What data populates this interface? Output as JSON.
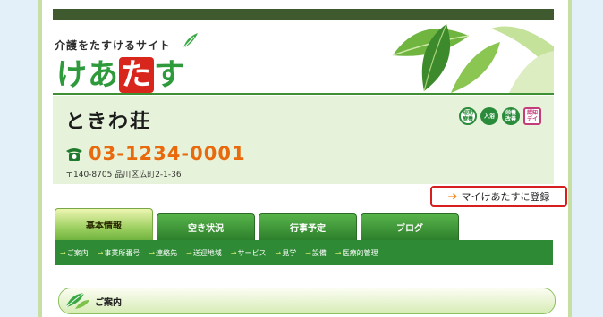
{
  "header": {
    "tagline": "介護をたすけるサイト",
    "logo": {
      "part1": "けあ",
      "highlight": "た",
      "part2": "す"
    }
  },
  "facility": {
    "name": "ときわ荘",
    "phone": "03-1234-0001",
    "address": "〒140-8705 品川区広町2-1-36",
    "badges": [
      {
        "label": "短期\n療養",
        "icon": "short-stay-icon"
      },
      {
        "label": "入浴",
        "icon": "bath-icon"
      },
      {
        "label": "栄養\n改善",
        "icon": "nutrition-icon"
      },
      {
        "label": "認知\nデイ",
        "icon": "dementia-day-icon"
      }
    ]
  },
  "mypage_button": {
    "label": "マイけあたすに登録"
  },
  "tabs": [
    {
      "label": "基本情報"
    },
    {
      "label": "空き状況"
    },
    {
      "label": "行事予定"
    },
    {
      "label": "ブログ"
    }
  ],
  "subnav": [
    "ご案内",
    "事業所番号",
    "連絡先",
    "送迎地域",
    "サービス",
    "見学",
    "設備",
    "医療的管理"
  ],
  "section": {
    "title": "ご案内"
  },
  "colors": {
    "brand_green": "#2f9a3c",
    "accent_orange": "#e86a0c",
    "alert_red": "#d81f1f"
  }
}
